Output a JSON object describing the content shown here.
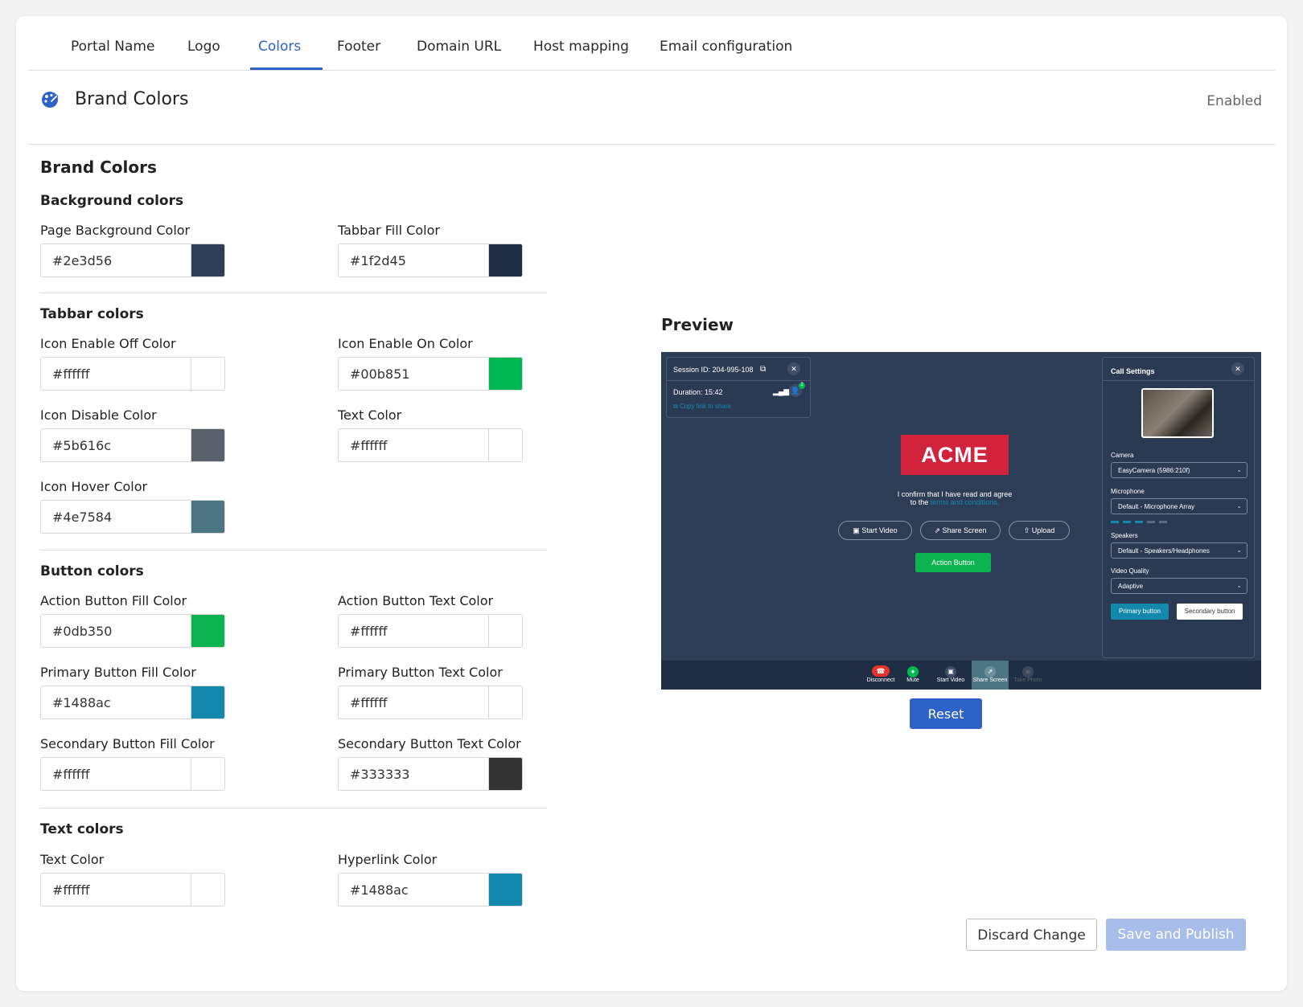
{
  "tabs": [
    "Portal Name",
    "Logo",
    "Colors",
    "Footer",
    "Domain URL",
    "Host mapping",
    "Email configuration"
  ],
  "header": {
    "title": "Brand Colors",
    "status": "Enabled"
  },
  "section_title": "Brand Colors",
  "groups": {
    "background": {
      "title": "Background colors",
      "fields": [
        {
          "label": "Page Background Color",
          "value": "#2e3d56"
        },
        {
          "label": "Tabbar Fill Color",
          "value": "#1f2d45"
        }
      ]
    },
    "tabbar": {
      "title": "Tabbar colors",
      "fields": [
        {
          "label": "Icon Enable Off Color",
          "value": "#ffffff"
        },
        {
          "label": "Icon Enable On Color",
          "value": "#00b851"
        },
        {
          "label": "Icon Disable Color",
          "value": "#5b616c"
        },
        {
          "label": "Text Color",
          "value": "#ffffff"
        },
        {
          "label": "Icon Hover Color",
          "value": "#4e7584"
        }
      ]
    },
    "button": {
      "title": "Button colors",
      "fields": [
        {
          "label": "Action Button Fill Color",
          "value": "#0db350"
        },
        {
          "label": "Action Button Text Color",
          "value": "#ffffff"
        },
        {
          "label": "Primary Button Fill Color",
          "value": "#1488ac"
        },
        {
          "label": "Primary Button Text Color",
          "value": "#ffffff"
        },
        {
          "label": "Secondary Button Fill Color",
          "value": "#ffffff"
        },
        {
          "label": "Secondary Button Text Color",
          "value": "#333333"
        }
      ]
    },
    "text": {
      "title": "Text colors",
      "fields": [
        {
          "label": "Text Color",
          "value": "#ffffff"
        },
        {
          "label": "Hyperlink Color",
          "value": "#1488ac"
        }
      ]
    }
  },
  "preview": {
    "title": "Preview",
    "session_id": "Session ID: 204-995-108",
    "duration": "Duration: 15:42",
    "copy_link": "Copy link to share",
    "logo": "ACME",
    "consent_line1": "I confirm that I have read and agree",
    "consent_line2": "to the ",
    "consent_link": "terms and conditions.",
    "pills": [
      "Start Video",
      "Share Screen",
      "Upload"
    ],
    "action_button": "Action Button",
    "call_settings": "Call Settings",
    "camera_label": "Camera",
    "camera_value": "EasyCamera (5986:210f)",
    "mic_label": "Microphone",
    "mic_value": "Default - Microphone Array",
    "speakers_label": "Speakers",
    "speakers_value": "Default - Speakers/Headphones",
    "quality_label": "Video Quality",
    "quality_value": "Adaptive",
    "primary_button": "Primary button",
    "secondary_button": "Secondary button",
    "toolbar": [
      "Disconnect",
      "Mute",
      "Start Video",
      "Share Screen",
      "Take Photo"
    ],
    "participants_badge": "2"
  },
  "actions": {
    "reset": "Reset",
    "discard": "Discard Change",
    "save": "Save and Publish"
  }
}
